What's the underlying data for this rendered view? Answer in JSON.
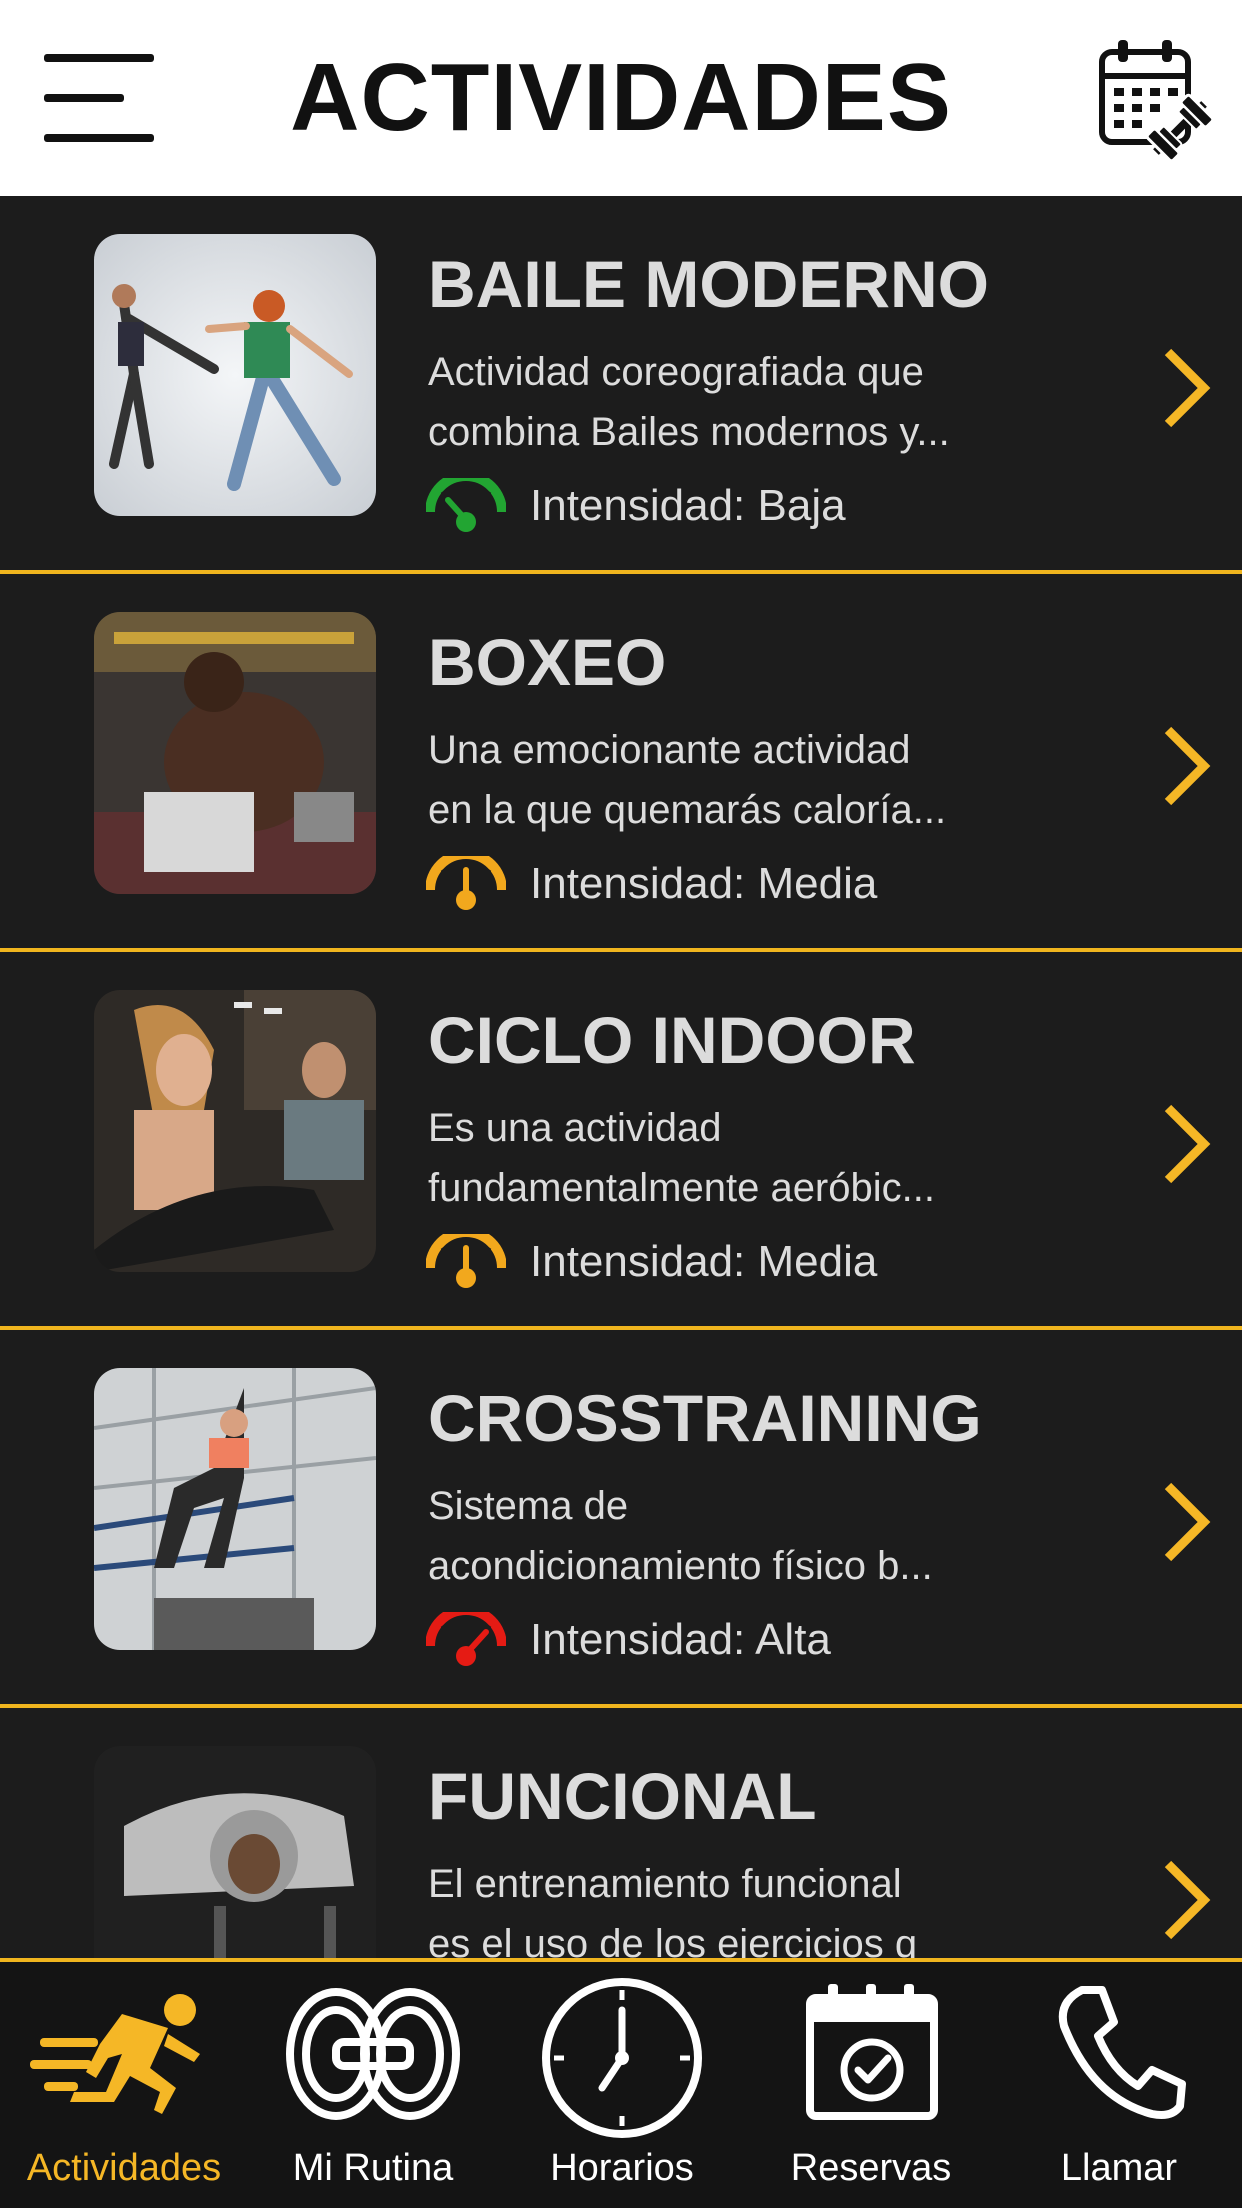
{
  "header": {
    "title": "ACTIVIDADES",
    "menu_icon": "hamburger-menu-icon",
    "calendar_icon": "calendar-dumbbell-icon"
  },
  "colors": {
    "accent": "#f0b51e",
    "background": "#1c1c1c",
    "text": "#dcdcdc",
    "intensity_low": "#22a532",
    "intensity_medium": "#f2a81d",
    "intensity_high": "#e51b14"
  },
  "activities": [
    {
      "name": "BAILE MODERNO",
      "desc_line1": "Actividad coreografiada que",
      "desc_line2": "combina Bailes modernos y...",
      "intensity": "Intensidad: Baja",
      "level": "low"
    },
    {
      "name": "BOXEO",
      "desc_line1": "Una emocionante actividad",
      "desc_line2": "en la que quemarás caloría...",
      "intensity": "Intensidad: Media",
      "level": "medium"
    },
    {
      "name": "CICLO INDOOR",
      "desc_line1": "Es una actividad",
      "desc_line2": "fundamentalmente aeróbic...",
      "intensity": "Intensidad: Media",
      "level": "medium"
    },
    {
      "name": "CROSSTRAINING",
      "desc_line1": "Sistema de",
      "desc_line2": "acondicionamiento físico b...",
      "intensity": "Intensidad: Alta",
      "level": "high"
    },
    {
      "name": "FUNCIONAL",
      "desc_line1": "El entrenamiento funcional",
      "desc_line2": "es el uso de los ejercicios q",
      "intensity": "",
      "level": "none"
    }
  ],
  "nav": {
    "items": [
      {
        "label": "Actividades",
        "icon": "running-man-icon",
        "active": true
      },
      {
        "label": "Mi Rutina",
        "icon": "weight-plates-icon",
        "active": false
      },
      {
        "label": "Horarios",
        "icon": "clock-icon",
        "active": false
      },
      {
        "label": "Reservas",
        "icon": "calendar-check-icon",
        "active": false
      },
      {
        "label": "Llamar",
        "icon": "phone-icon",
        "active": false
      }
    ]
  }
}
